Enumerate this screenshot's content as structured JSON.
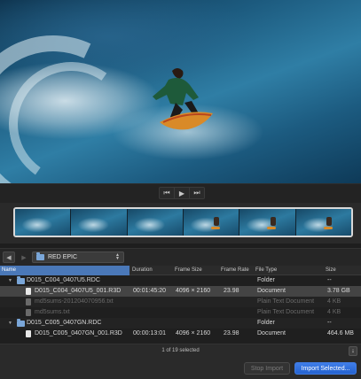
{
  "transport": {
    "prev_icon": "skip-back-icon",
    "play_icon": "play-icon",
    "next_icon": "skip-forward-icon"
  },
  "filmstrip": {
    "frames": 6
  },
  "navbar": {
    "back_icon": "back-arrow-icon",
    "forward_icon": "forward-arrow-icon",
    "location": "RED EPIC"
  },
  "table": {
    "columns": [
      "Name",
      "Duration",
      "Frame Size",
      "Frame Rate",
      "File Type",
      "Size"
    ],
    "rows": [
      {
        "name": "D015_C004_0407U5.RDC",
        "duration": "",
        "frame_size": "",
        "frame_rate": "",
        "file_type": "Folder",
        "size": "--"
      },
      {
        "name": "D015_C004_0407U5_001.R3D",
        "duration": "00:01:45:20",
        "frame_size": "4096 × 2160",
        "frame_rate": "23.98",
        "file_type": "Document",
        "size": "3.78 GB"
      },
      {
        "name": "md5sums-20120407095​6.txt",
        "duration": "",
        "frame_size": "",
        "frame_rate": "",
        "file_type": "Plain Text Document",
        "size": "4 KB"
      },
      {
        "name": "md5sums.txt",
        "duration": "",
        "frame_size": "",
        "frame_rate": "",
        "file_type": "Plain Text Document",
        "size": "4 KB"
      },
      {
        "name": "D015_C005_0407GN.RDC",
        "duration": "",
        "frame_size": "",
        "frame_rate": "",
        "file_type": "Folder",
        "size": "--"
      },
      {
        "name": "D015_C005_0407GN_001.R3D",
        "duration": "00:00:13:01",
        "frame_size": "4096 × 2160",
        "frame_rate": "23.98",
        "file_type": "Document",
        "size": "464.6 MB"
      }
    ]
  },
  "status": {
    "text": "1 of 19 selected"
  },
  "buttons": {
    "stop": "Stop Import",
    "import": "Import Selected..."
  },
  "colors": {
    "accent": "#2f6fdc",
    "selection": "#444444",
    "header_active": "#4a78b8"
  }
}
